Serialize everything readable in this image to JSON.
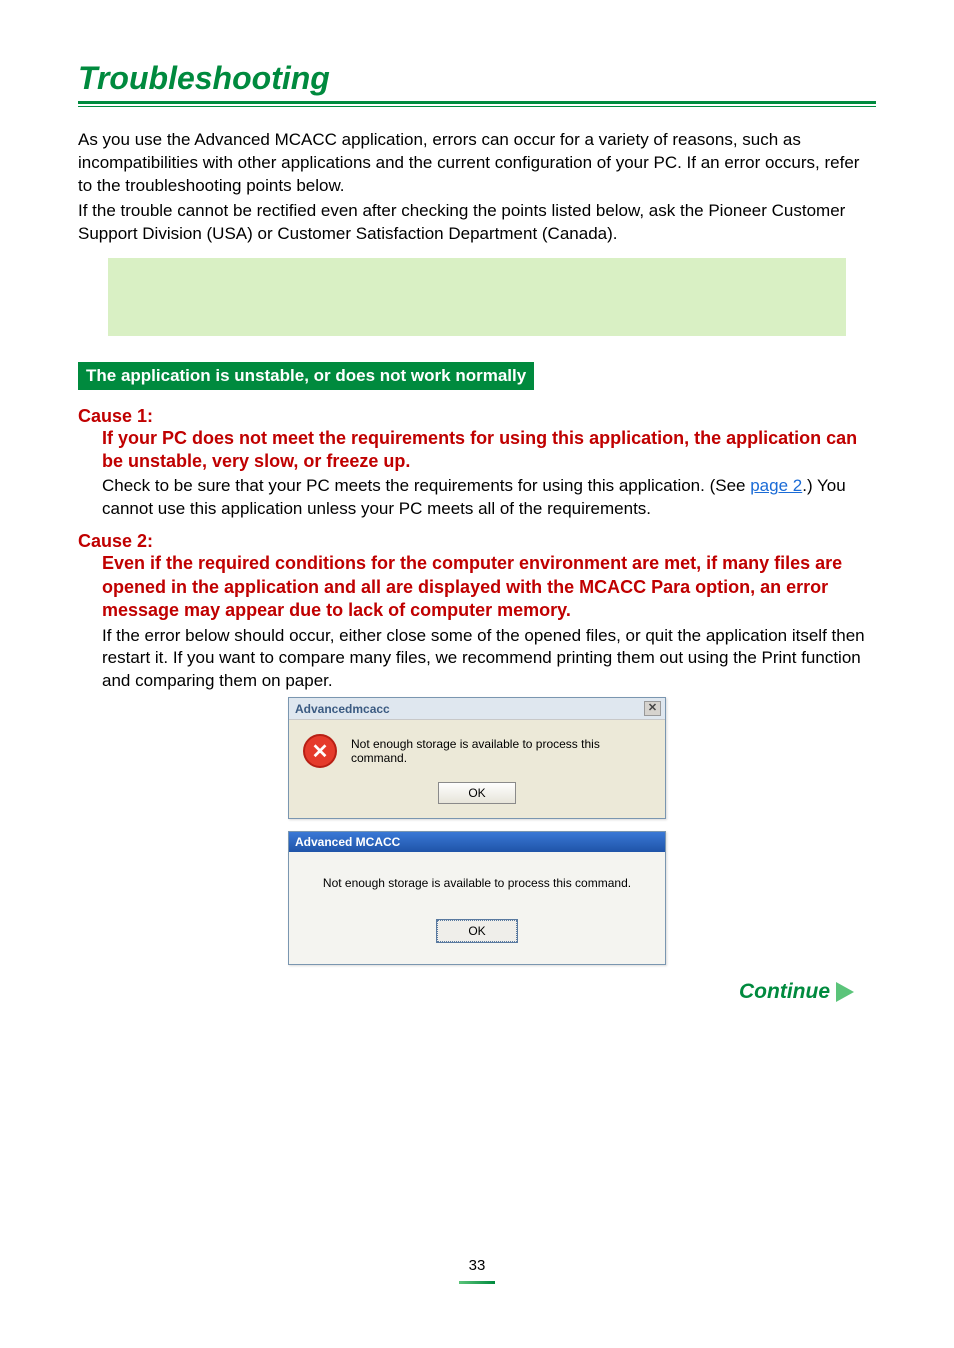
{
  "title": "Troubleshooting",
  "intro1": "As you use the Advanced MCACC application, errors can occur for a variety of reasons, such as incompatibilities with other applications and the current configuration of your PC. If an error occurs, refer to the troubleshooting points below.",
  "intro2": "If the trouble cannot be rectified even after checking the points listed below, ask the Pioneer Customer Support Division (USA) or Customer Satisfaction Department (Canada).",
  "section_banner": "The application is unstable, or does not work normally",
  "cause1": {
    "label": "Cause 1:",
    "heading": "If your PC does not meet the requirements for using this application, the application can be unstable, very slow, or freeze up.",
    "body_before_link": "Check to be sure that your PC meets the requirements for using this application. (See ",
    "link_text": "page 2",
    "body_after_link": ".) You cannot use this application unless your PC meets all of the requirements."
  },
  "cause2": {
    "label": "Cause 2:",
    "heading": "Even if the required conditions for the computer environment are met, if many files are opened in the application and all are displayed with the MCACC Para option, an error message may appear due to lack of computer memory.",
    "body": "If the error below should occur, either close some of the opened files, or quit the application itself then restart it. If you want to compare many files, we recommend printing them out using the Print function and comparing them on paper."
  },
  "dialog1": {
    "title": "Advancedmcacc",
    "close": "✕",
    "message": "Not enough storage is available to process this command.",
    "ok": "OK"
  },
  "dialog2": {
    "title": "Advanced MCACC",
    "message": "Not enough storage is available to process this command.",
    "ok": "OK"
  },
  "continue": "Continue",
  "page_number": "33"
}
